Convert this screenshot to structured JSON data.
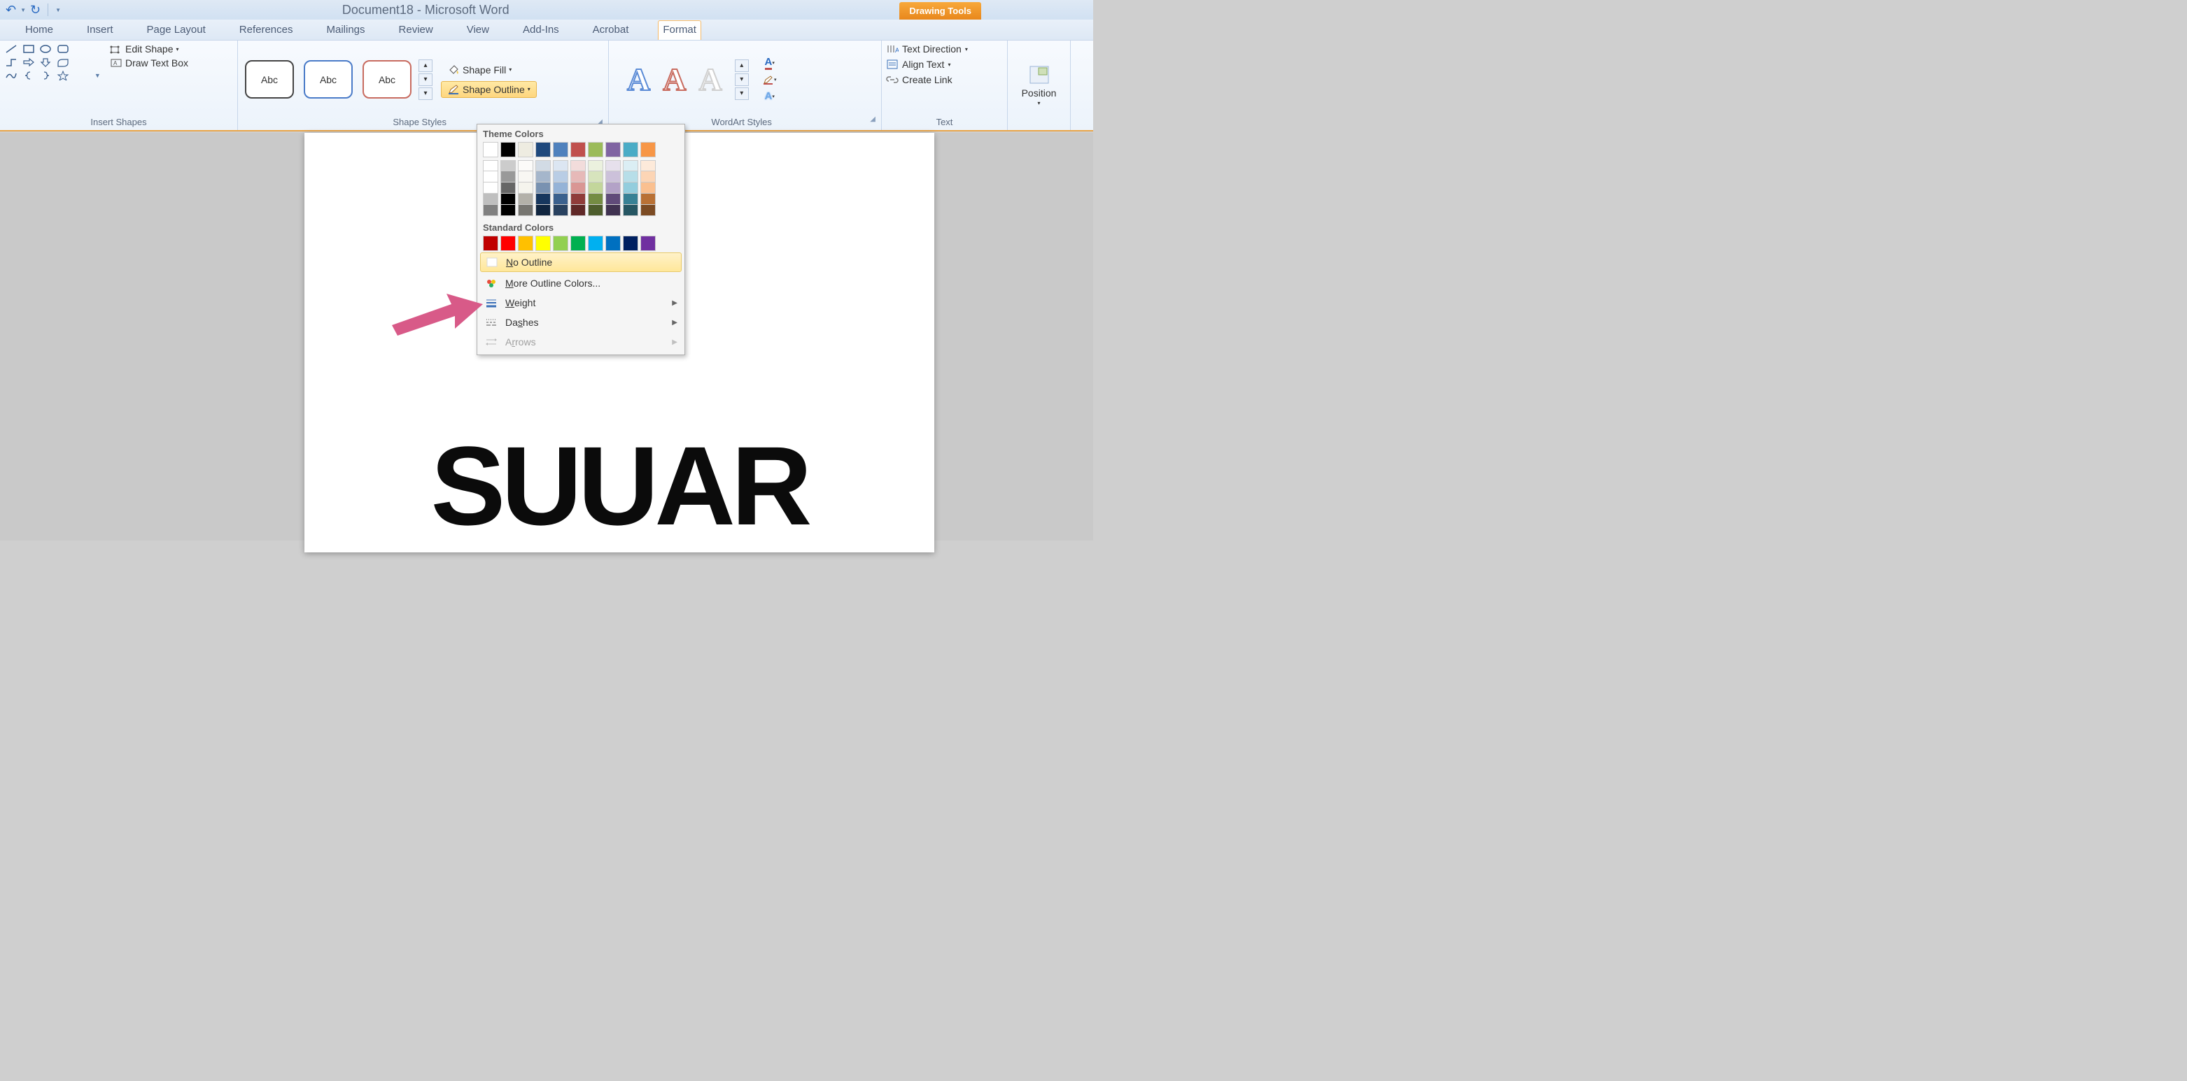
{
  "title": "Document18 - Microsoft Word",
  "contextual_tab": "Drawing Tools",
  "tabs": [
    "Home",
    "Insert",
    "Page Layout",
    "References",
    "Mailings",
    "Review",
    "View",
    "Add-Ins",
    "Acrobat",
    "Format"
  ],
  "active_tab_index": 9,
  "groups": {
    "insert_shapes": {
      "label": "Insert Shapes",
      "edit_shape": "Edit Shape",
      "draw_text_box": "Draw Text Box"
    },
    "shape_styles": {
      "label": "Shape Styles",
      "sample_text": "Abc",
      "shape_fill": "Shape Fill",
      "shape_outline": "Shape Outline"
    },
    "wordart": {
      "label": "WordArt Styles"
    },
    "text": {
      "label": "Text",
      "text_direction": "Text Direction",
      "align_text": "Align Text",
      "create_link": "Create Link"
    },
    "arrange": {
      "position": "Position"
    }
  },
  "outline_dropdown": {
    "theme_label": "Theme Colors",
    "theme_colors": [
      "#ffffff",
      "#000000",
      "#eeece1",
      "#1f497d",
      "#4f81bd",
      "#c0504d",
      "#9bbb59",
      "#8064a2",
      "#4bacc6",
      "#f79646"
    ],
    "std_label": "Standard Colors",
    "std_colors": [
      "#c00000",
      "#ff0000",
      "#ffc000",
      "#ffff00",
      "#92d050",
      "#00b050",
      "#00b0f0",
      "#0070c0",
      "#002060",
      "#7030a0"
    ],
    "no_outline": "No Outline",
    "more_colors": "More Outline Colors...",
    "weight": "Weight",
    "dashes": "Dashes",
    "arrows": "Arrows"
  },
  "document_text": "SUUAR"
}
